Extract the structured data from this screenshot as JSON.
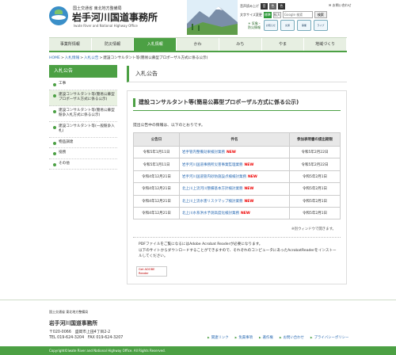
{
  "header": {
    "org_small": "国土交通省 東北地方整備局",
    "title": "岩手河川国道事務所",
    "subtitle": "Iwate River and National Highway Office",
    "audio_label": "音声読み上げ",
    "lang_buttons": [
      "音",
      "色",
      "色"
    ],
    "inquiry": "お問い合わせ",
    "text_size_label": "文字サイズ変更",
    "size_buttons": [
      "標準",
      "拡大"
    ],
    "search_placeholder": "Google 検索",
    "search_button": "検索",
    "weather": "気象・",
    "weather2": "防災情報",
    "icon_cards": [
      "お知らせ",
      "交通",
      "事業",
      "ライブ"
    ]
  },
  "nav": {
    "items": [
      "事業所情報",
      "防災情報",
      "入札情報",
      "かわ",
      "みち",
      "やま",
      "地域づくり"
    ]
  },
  "breadcrumb": {
    "items": [
      "HOME",
      "入札情報",
      "入札公告",
      "建設コンサルタント等(簡易公募型プロポーザル方式に係る公示)"
    ]
  },
  "sidebar": {
    "heading": "入札公告",
    "items": [
      "工事",
      "建設コンサルタント等(簡易公募型プロポーザル方式に係る公示)",
      "建設コンサルタント等(簡易公募型競争入札方式に係る公示)",
      "建設コンサルタント等(一般競争入札)",
      "物品調達",
      "役務",
      "その他"
    ]
  },
  "main": {
    "page_title": "入札公告",
    "section_title": "建設コンサルタント等(簡易公募型プロポーザル方式に係る公示)",
    "intro": "提出公告中の情報は、以下のとおりです。",
    "table": {
      "headers": [
        "公告日",
        "件名",
        "参加表明書の提出期限"
      ],
      "rows": [
        {
          "date": "令和5年1月11日",
          "name": "岩手管内整備効果検討業務",
          "new": "NEW",
          "deadline": "令和5年2月22日"
        },
        {
          "date": "令和5年1月11日",
          "name": "岩手河川国道事務所災害事業監理業務",
          "new": "NEW",
          "deadline": "令和5年2月22日"
        },
        {
          "date": "令和4年12月21日",
          "name": "岩手河川国道管内砂防施設点検検討業務",
          "new": "NEW",
          "deadline": "令和5年2月1日"
        },
        {
          "date": "令和4年12月21日",
          "name": "北上川上流河川整備基本方針検討業務",
          "new": "NEW",
          "deadline": "令和5年2月1日"
        },
        {
          "date": "令和4年12月21日",
          "name": "北上川上流水害リスクマップ検討業務",
          "new": "NEW",
          "deadline": "令和5年2月1日"
        },
        {
          "date": "令和4年12月21日",
          "name": "北上川水系洪水予測高度化検討業務",
          "new": "NEW",
          "deadline": "令和5年2月1日"
        }
      ]
    },
    "new_window_note": "※別ウィンドウで開きます。",
    "pdf_line1": "PDFファイルをご覧になるにはAdobe Acrobat Readerが必要になります。",
    "pdf_line2": "以下のサイトからダウンロードすることができますので、それぞれのコンピュータにあったAcrobatReaderをインストールしてください。",
    "adobe_label": "Get ADOBE Reader"
  },
  "footer": {
    "org_small": "国土交通省 東北地方整備局",
    "title": "岩手河川国道事務所",
    "postal": "〒020-0066　盛岡市上田4丁目2-2",
    "tel": "TEL 019-624-3204　FAX 019-624-3207",
    "links": [
      "関連リンク",
      "免責事項",
      "著作権",
      "お問い合わせ",
      "プライバシーポリシー"
    ],
    "copyright": "Copyright©Iwate River and National Highway Office. All Rights Reserved."
  },
  "colors": {
    "accent": "#4ca044",
    "link": "#2b6bb3",
    "new": "#ee0000"
  }
}
